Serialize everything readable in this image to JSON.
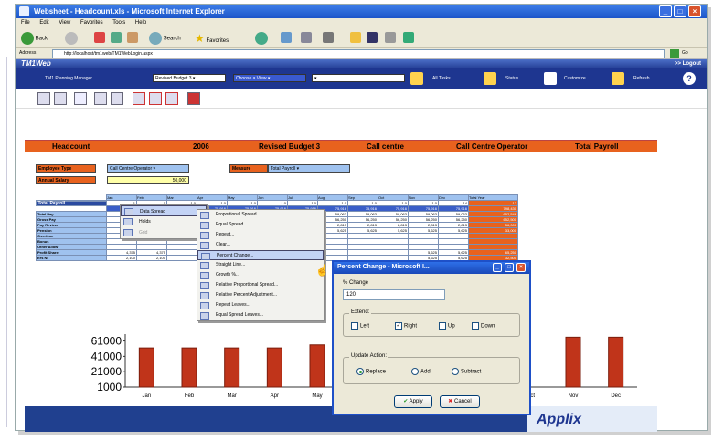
{
  "window": {
    "title": "Websheet - Headcount.xls - Microsoft Internet Explorer"
  },
  "menu": [
    "File",
    "Edit",
    "View",
    "Favorites",
    "Tools",
    "Help"
  ],
  "toolbar": {
    "back": "Back",
    "search": "Search",
    "favorites": "Favorites"
  },
  "address": {
    "label": "Address",
    "url": "http://localhost/tm1web/TM1WebLogin.aspx",
    "go": "Go"
  },
  "tm1": {
    "brand": "TM1Web",
    "logout": ">> Logout"
  },
  "nav": {
    "manager": "TM1 Planning Manager",
    "version": "Revised Budget 3",
    "view": "Choose a View",
    "all_tasks": "All Tasks",
    "status": "Status",
    "customize": "Customize",
    "refresh": "Refresh"
  },
  "header": {
    "title": "Headcount",
    "year": "2006",
    "version": "Revised Budget 3",
    "dept": "Call centre",
    "role": "Call Centre Operator",
    "measure": "Total Payroll"
  },
  "form": {
    "emp_type_label": "Employee Type",
    "emp_type_value": "Call Centre Operator",
    "measure_label": "Measure",
    "measure_value": "Total Payroll",
    "salary_label": "Annual Salary",
    "salary_value": "50,000"
  },
  "grid": {
    "months": [
      "Jan",
      "Feb",
      "Mar",
      "Apr",
      "May",
      "Jun",
      "Jul",
      "Aug",
      "Sep",
      "Oct",
      "Nov",
      "Dec"
    ],
    "total_label": "Total Year",
    "rows": [
      {
        "label": "FTE",
        "cells": [
          "1",
          "1",
          "1.0",
          "1.0",
          "1.0",
          "1.0",
          "1.0",
          "1.0",
          "1.0",
          "1.0",
          "1.0",
          "14"
        ],
        "total": "12"
      },
      {
        "label": "Total Payroll",
        "cells": [
          "",
          "",
          "75,916",
          "75,916",
          "75,916",
          "75,916",
          "75,916",
          "75,916",
          "75,916",
          "75,916",
          "75,916",
          "75,916"
        ],
        "total": "798,430"
      },
      {
        "label": "Total Pay",
        "cells": [
          "",
          "",
          "59,063",
          "59,063",
          "59,063",
          "59,063",
          "59,063",
          "59,063",
          "59,063",
          "59,063",
          "59,063",
          "59,063"
        ],
        "total": "652,546"
      },
      {
        "label": "Gross Pay",
        "cells": [
          "",
          "",
          "56,250",
          "56,250",
          "56,250",
          "56,250",
          "56,250",
          "56,250",
          "56,250",
          "56,250",
          "56,250",
          "56,250"
        ],
        "total": "652,500"
      },
      {
        "label": "Pay Review",
        "cells": [
          "",
          "",
          "2,813",
          "2,813",
          "2,813",
          "2,813",
          "2,813",
          "2,813",
          "2,813",
          "2,813",
          "2,813",
          "2,813"
        ],
        "total": "56,000"
      },
      {
        "label": "Pension",
        "cells": [
          "2,100",
          "2,100",
          "5,625",
          "5,625",
          "5,625",
          "5,625",
          "5,625",
          "5,625",
          "5,625",
          "5,625",
          "5,625",
          "5,625"
        ],
        "total": "33,000"
      },
      {
        "label": "Overtime",
        "cells": [
          "",
          "",
          "",
          "",
          "",
          "",
          "",
          "",
          "",
          "",
          "",
          ""
        ],
        "total": ""
      },
      {
        "label": "Bonus",
        "cells": [
          "",
          "",
          "",
          "",
          "",
          "",
          "",
          "",
          "",
          "",
          "",
          ""
        ],
        "total": ""
      },
      {
        "label": "Other Allow",
        "cells": [
          "",
          "",
          "",
          "",
          "",
          "",
          "",
          "",
          "",
          "",
          "",
          ""
        ],
        "total": ""
      },
      {
        "label": "Profit Share",
        "cells": [
          "4,375",
          "4,375",
          "",
          "",
          "",
          "",
          "",
          "",
          "",
          "",
          "5,625",
          "5,625"
        ],
        "total": "65,250"
      },
      {
        "label": "Ers NI",
        "cells": [
          "2,100",
          "2,100",
          "",
          "",
          "",
          "",
          "",
          "",
          "",
          "",
          "5,625",
          "5,625"
        ],
        "total": "32,500"
      }
    ]
  },
  "context_menu": {
    "items": [
      "Data Spread",
      "Holds",
      "Grid"
    ]
  },
  "spread_menu": {
    "items": [
      "Proportional Spread...",
      "Equal Spread...",
      "Repeat...",
      "Clear...",
      "Percent Change...",
      "Straight Line...",
      "Growth %...",
      "Relative Proportional Spread...",
      "Relative Percent Adjustment...",
      "Repeat Leaves...",
      "Equal Spread Leaves..."
    ]
  },
  "dialog": {
    "title": "Percent Change - Microsoft I...",
    "pct_label": "% Change",
    "pct_value": "120",
    "extend_label": "Extend:",
    "left": "Left",
    "right": "Right",
    "up": "Up",
    "down": "Down",
    "update_label": "Update Action:",
    "replace": "Replace",
    "add": "Add",
    "subtract": "Subtract",
    "apply": "Apply",
    "cancel": "Cancel"
  },
  "chart_data": {
    "type": "bar",
    "categories": [
      "Jan",
      "Feb",
      "Mar",
      "Apr",
      "May",
      "Jun",
      "Jul",
      "Aug",
      "Sep",
      "Oct",
      "Nov",
      "Dec"
    ],
    "values": [
      52000,
      52000,
      52000,
      52000,
      56000,
      null,
      null,
      null,
      null,
      null,
      66000,
      66000
    ],
    "yticks": [
      "61000",
      "41000",
      "21000",
      "1000"
    ],
    "ylim": [
      1000,
      70000
    ],
    "color": "#c0341a"
  },
  "branding": {
    "logo": "Applix"
  }
}
